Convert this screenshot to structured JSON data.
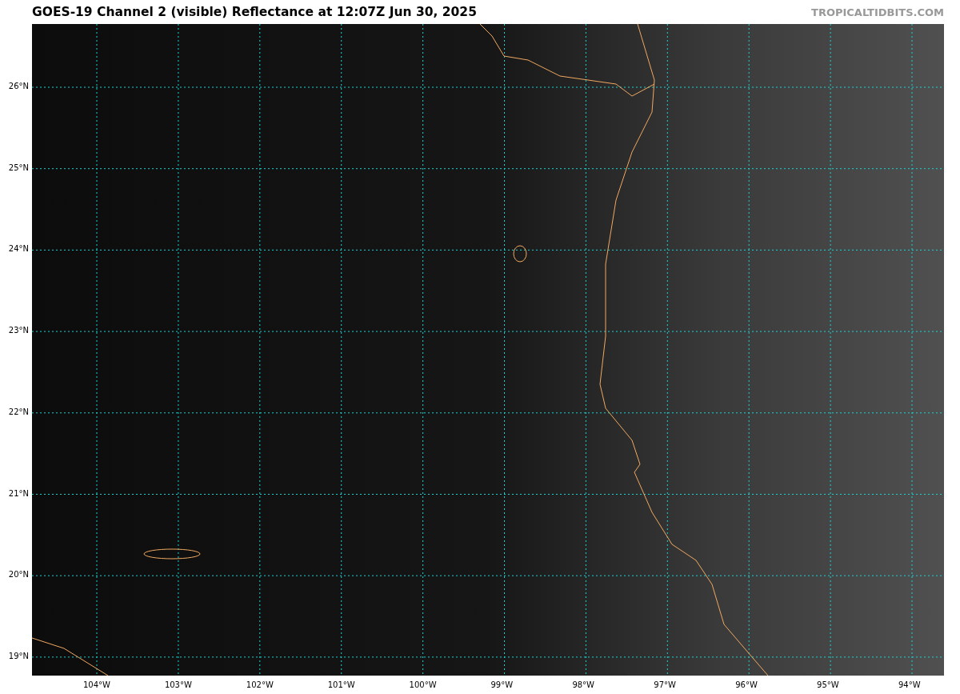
{
  "title": "GOES-19 Channel 2 (visible) Reflectance at 12:07Z Jun 30, 2025",
  "site": "TROPICALTIDBITS.COM",
  "lat_labels": [
    "26°N",
    "25°N",
    "24°N",
    "23°N",
    "22°N",
    "21°N",
    "20°N",
    "19°N"
  ],
  "lon_labels": [
    "104°W",
    "103°W",
    "102°W",
    "101°W",
    "100°W",
    "99°W",
    "98°W",
    "97°W",
    "96°W",
    "95°W",
    "94°W"
  ]
}
